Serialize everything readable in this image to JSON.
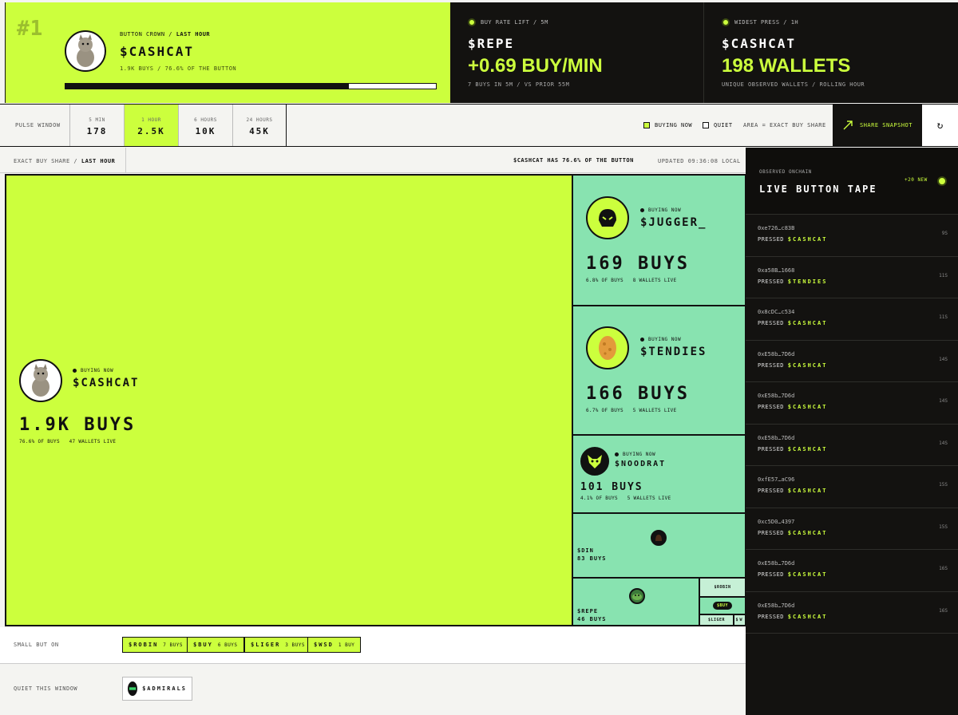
{
  "crown": {
    "rank": "#1",
    "kicker": "BUTTON CROWN / ",
    "kicker_bold": "LAST HOUR",
    "name": "$CASHCAT",
    "sub": "1.9K BUYS / 76.6% OF THE BUTTON",
    "share_pct": 76.6
  },
  "stats": [
    {
      "kicker": "BUY RATE LIFT / 5M",
      "token": "$REPE",
      "value": "+0.69 BUY/MIN",
      "sub": "7 BUYS IN 5M / VS PRIOR 55M"
    },
    {
      "kicker": "WIDEST PRESS / 1H",
      "token": "$CASHCAT",
      "value": "198 WALLETS",
      "sub": "UNIQUE OBSERVED WALLETS / ROLLING HOUR"
    }
  ],
  "pulse": {
    "label": "PULSE WINDOW",
    "cells": [
      {
        "k": "5 MIN",
        "v": "178"
      },
      {
        "k": "1 HOUR",
        "v": "2.5K"
      },
      {
        "k": "6 HOURS",
        "v": "10K"
      },
      {
        "k": "24 HOURS",
        "v": "45K"
      }
    ],
    "legend_buying": "BUYING NOW",
    "legend_quiet": "QUIET",
    "legend_area": "AREA = EXACT BUY SHARE",
    "share": "SHARE SNAPSHOT",
    "refresh": "↻"
  },
  "share_header": {
    "left": "EXACT BUY SHARE / ",
    "left_bold": "LAST HOUR",
    "middle": "$CASHCAT HAS 76.6% OF THE BUTTON",
    "right": "UPDATED 09:36:08 LOCAL"
  },
  "treemap": {
    "main": {
      "now": "BUYING NOW",
      "token": "$CASHCAT",
      "buys": "1.9K BUYS",
      "pct": "76.6% OF BUYS",
      "wallets": "47 WALLETS LIVE"
    },
    "jugger": {
      "now": "BUYING NOW",
      "token": "$JUGGER_",
      "buys": "169 BUYS",
      "pct": "6.8% OF BUYS",
      "wallets": "8 WALLETS LIVE"
    },
    "tendies": {
      "now": "BUYING NOW",
      "token": "$TENDIES",
      "buys": "166 BUYS",
      "pct": "6.7% OF BUYS",
      "wallets": "5 WALLETS LIVE"
    },
    "noodrat": {
      "now": "BUYING NOW",
      "token": "$NOODRAT",
      "buys": "101 BUYS",
      "pct": "4.1% OF BUYS",
      "wallets": "5 WALLETS LIVE"
    },
    "din": {
      "token": "$DIN",
      "buys": "83 BUYS"
    },
    "repe": {
      "token": "$REPE",
      "buys": "46 BUYS"
    },
    "robin": "$ROBIN",
    "buy": "$BUY",
    "liger": "$LIGER",
    "w": "$W"
  },
  "small_but_on": {
    "label": "SMALL BUT ON",
    "chips": [
      {
        "token": "$ROBIN",
        "buys": "7 BUYS"
      },
      {
        "token": "$BUY",
        "buys": "6 BUYS"
      },
      {
        "token": "$LIGER",
        "buys": "3 BUYS"
      },
      {
        "token": "$WSD",
        "buys": "1 BUY"
      }
    ]
  },
  "quiet": {
    "label": "QUIET THIS WINDOW",
    "token": "$ADMIRALS"
  },
  "tape": {
    "kicker": "OBSERVED ONCHAIN",
    "title": "LIVE BUTTON TAPE",
    "new": "+20 NEW",
    "rows": [
      {
        "wallet": "0xe726…c83B",
        "action": "PRESSED",
        "token": "$CASHCAT",
        "age": "9S"
      },
      {
        "wallet": "0xa58B…1668",
        "action": "PRESSED",
        "token": "$TENDIES",
        "age": "11S"
      },
      {
        "wallet": "0x8cDC…c534",
        "action": "PRESSED",
        "token": "$CASHCAT",
        "age": "11S"
      },
      {
        "wallet": "0xE58b…7D6d",
        "action": "PRESSED",
        "token": "$CASHCAT",
        "age": "14S"
      },
      {
        "wallet": "0xE58b…7D6d",
        "action": "PRESSED",
        "token": "$CASHCAT",
        "age": "14S"
      },
      {
        "wallet": "0xE58b…7D6d",
        "action": "PRESSED",
        "token": "$CASHCAT",
        "age": "14S"
      },
      {
        "wallet": "0xfE57…aC96",
        "action": "PRESSED",
        "token": "$CASHCAT",
        "age": "15S"
      },
      {
        "wallet": "0xc5D0…4397",
        "action": "PRESSED",
        "token": "$CASHCAT",
        "age": "15S"
      },
      {
        "wallet": "0xE58b…7D6d",
        "action": "PRESSED",
        "token": "$CASHCAT",
        "age": "16S"
      },
      {
        "wallet": "0xE58b…7D6d",
        "action": "PRESSED",
        "token": "$CASHCAT",
        "age": "16S"
      }
    ]
  },
  "colors": {
    "lime": "#ccff3d",
    "mint": "#88e3b0",
    "dark": "#131210"
  }
}
